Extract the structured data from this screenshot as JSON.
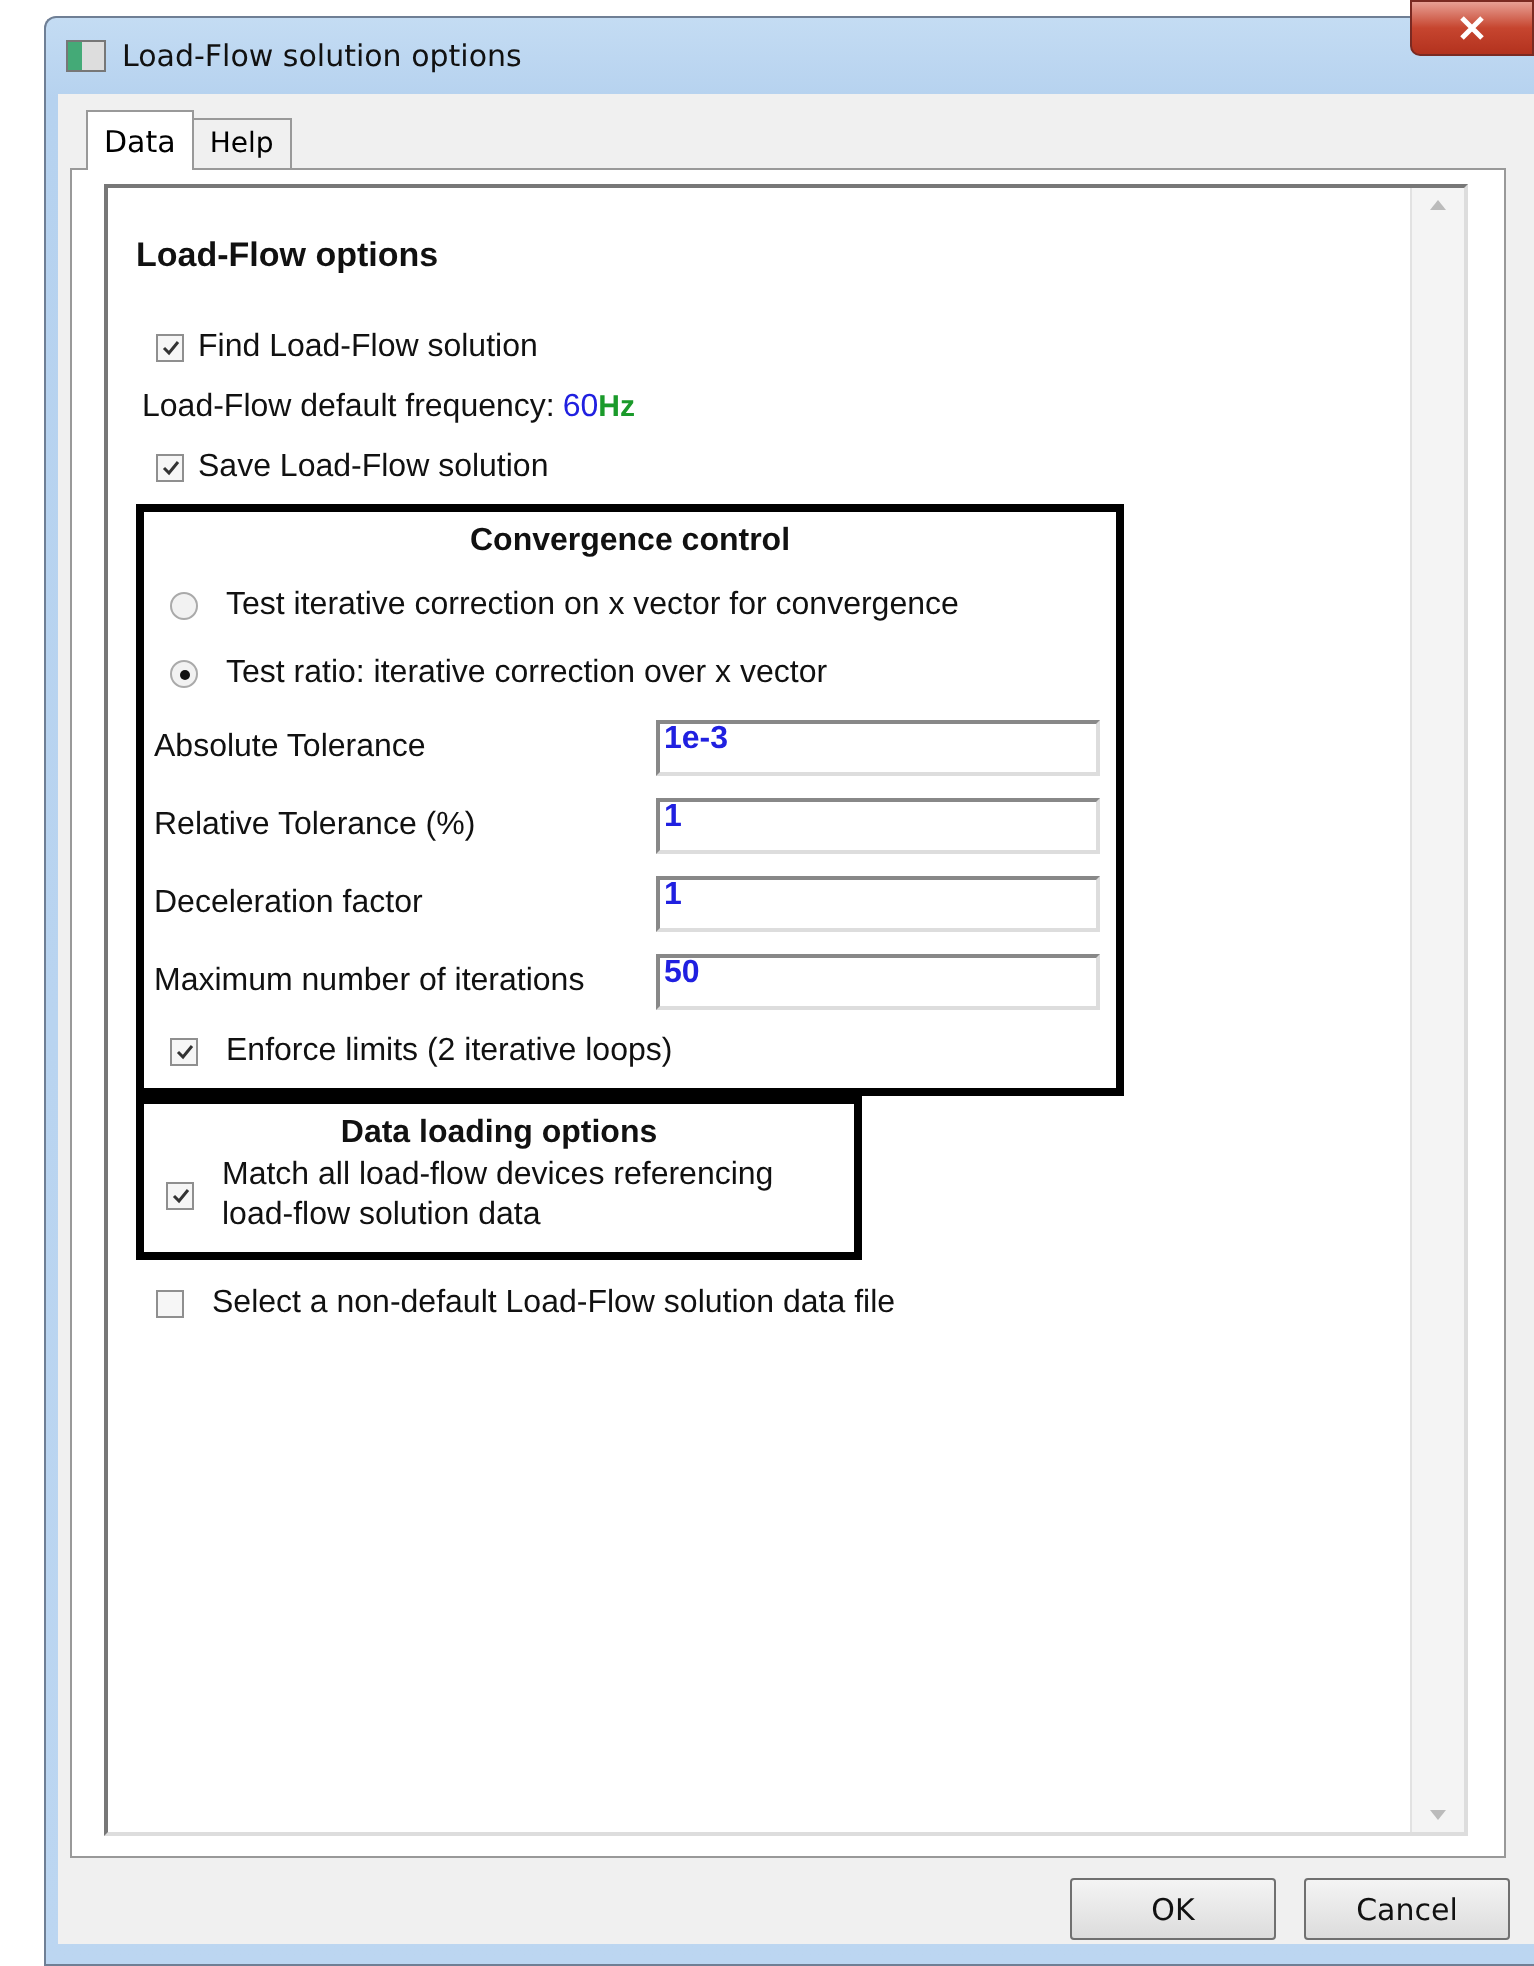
{
  "window": {
    "title": "Load-Flow solution options"
  },
  "tabs": [
    {
      "label": "Data",
      "selected": true
    },
    {
      "label": "Help",
      "selected": false
    }
  ],
  "heading": "Load-Flow options",
  "find_solution": {
    "label": "Find Load-Flow solution",
    "checked": true
  },
  "frequency": {
    "label": "Load-Flow default frequency:",
    "value": "60",
    "unit": "Hz"
  },
  "save_solution": {
    "label": "Save Load-Flow solution",
    "checked": true
  },
  "convergence": {
    "title": "Convergence control",
    "radios": [
      {
        "label": "Test iterative correction on x vector for convergence",
        "selected": false
      },
      {
        "label": "Test ratio: iterative correction over x vector",
        "selected": true
      }
    ],
    "fields": [
      {
        "label": "Absolute Tolerance",
        "value": "1e-3"
      },
      {
        "label": "Relative Tolerance (%)",
        "value": "1"
      },
      {
        "label": "Deceleration factor",
        "value": "1"
      },
      {
        "label": "Maximum number of iterations",
        "value": "50"
      }
    ],
    "enforce_limits": {
      "label": "Enforce limits (2 iterative loops)",
      "checked": true
    }
  },
  "data_loading": {
    "title": "Data loading options",
    "match_devices": {
      "label": "Match all load-flow devices referencing load-flow solution data",
      "checked": true
    }
  },
  "select_file": {
    "label": "Select a non-default Load-Flow solution data file",
    "checked": false
  },
  "buttons": [
    "OK",
    "Cancel"
  ]
}
